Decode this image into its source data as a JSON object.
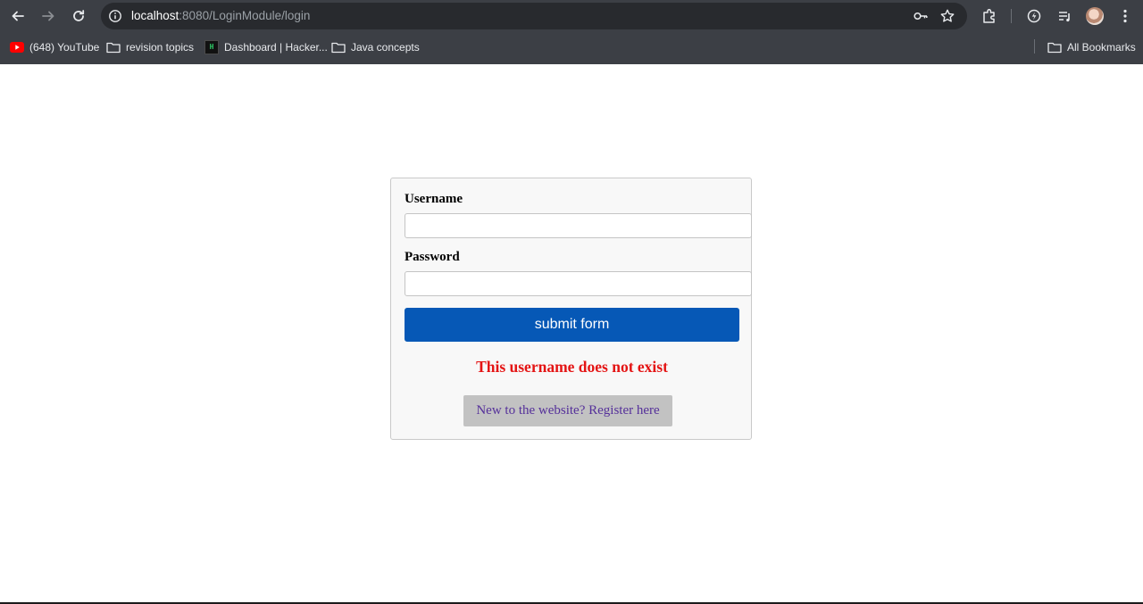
{
  "browser": {
    "url_host": "localhost",
    "url_rest": ":8080/LoginModule/login",
    "bookmarks": [
      {
        "label": "(648) YouTube",
        "icon": "youtube-icon"
      },
      {
        "label": "revision topics",
        "icon": "folder-icon"
      },
      {
        "label": "Dashboard | Hacker...",
        "icon": "hackerrank-icon"
      },
      {
        "label": "Java concepts",
        "icon": "folder-icon"
      }
    ],
    "all_bookmarks_label": "All Bookmarks"
  },
  "form": {
    "username_label": "Username",
    "username_value": "",
    "password_label": "Password",
    "password_value": "",
    "submit_label": "submit form",
    "error_message": "This username does not exist",
    "register_link": "New to the website? Register here"
  },
  "colors": {
    "submit_bg": "#0658b6",
    "error_text": "#e41414",
    "register_bg": "#c2c2c2",
    "register_text": "#55309a",
    "chrome_bg": "#3c3f45"
  }
}
